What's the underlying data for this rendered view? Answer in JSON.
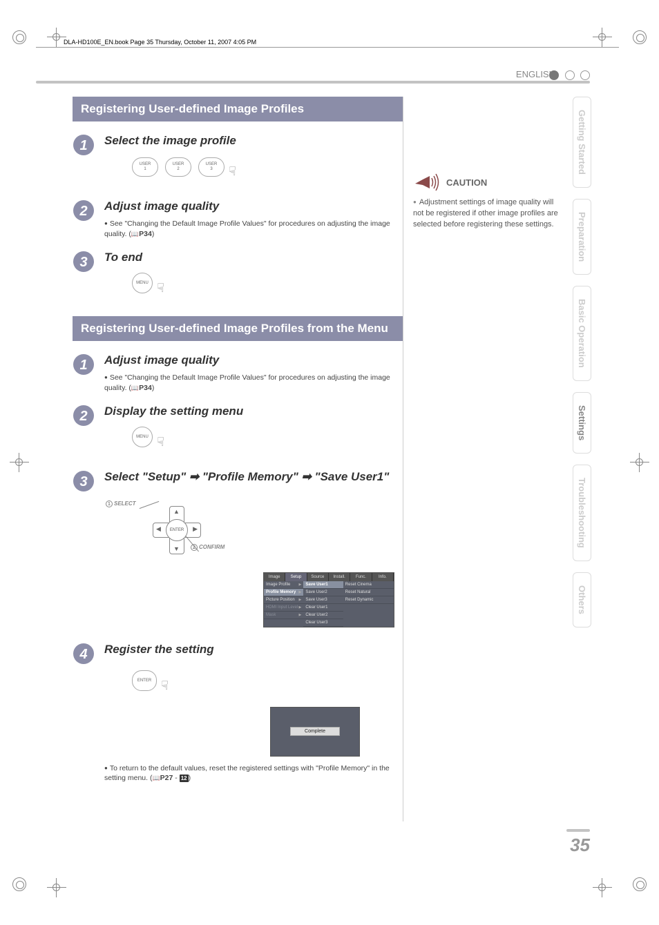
{
  "header_line": "DLA-HD100E_EN.book  Page 35  Thursday, October 11, 2007  4:05 PM",
  "top": {
    "language": "ENGLISH"
  },
  "side_tabs": [
    "Getting Started",
    "Preparation",
    "Basic Operation",
    "Settings",
    "Troubleshooting",
    "Others"
  ],
  "section1": {
    "title": "Registering User-defined Image Profiles",
    "step1": {
      "title": "Select the image profile",
      "btns": [
        "USER 1",
        "USER 2",
        "USER 3"
      ]
    },
    "step2": {
      "title": "Adjust image quality",
      "note": "See \"Changing the Default Image Profile Values\" for procedures on adjusting the image quality. (",
      "ref": "P34",
      "note_end": ")"
    },
    "step3": {
      "title": "To end",
      "btn": "MENU"
    }
  },
  "section2": {
    "title": "Registering User-defined Image Profiles from the Menu",
    "step1": {
      "title": "Adjust image quality",
      "note": "See \"Changing the Default Image Profile Values\" for procedures on adjusting the image quality. (",
      "ref": "P34",
      "note_end": ")"
    },
    "step2": {
      "title": "Display the setting menu",
      "btn": "MENU"
    },
    "step3": {
      "title_a": "Select \"Setup\" ",
      "title_b": " \"Profile Memory\" ",
      "title_c": " \"Save User1\"",
      "dpad": {
        "center": "ENTER",
        "label1": "SELECT",
        "label2": "CONFIRM"
      },
      "menu": {
        "tabs": [
          "Image",
          "Setup",
          "Source",
          "Install.",
          "Func.",
          "Info."
        ],
        "left": [
          "Image Profile",
          "Profile Memory",
          "Picture Position",
          "HDMI Input Level",
          "Mask"
        ],
        "mid": [
          "Save User1",
          "Save User2",
          "Save User3",
          "Clear User1",
          "Clear User2",
          "Clear User3"
        ],
        "right": [
          "Reset Cinema",
          "Reset Natural",
          "Reset Dynamic"
        ]
      }
    },
    "step4": {
      "title": "Register the setting",
      "btn": "ENTER",
      "complete": "Complete",
      "note": "To return to the default values, reset the registered settings with \"Profile Memory\" in the setting menu. (",
      "ref": "P27",
      "ref2": "12",
      "note_end": ")"
    }
  },
  "caution": {
    "heading": "CAUTION",
    "text": "Adjustment settings of image quality will not be registered if other image profiles are selected before registering these settings."
  },
  "page_number": "35"
}
